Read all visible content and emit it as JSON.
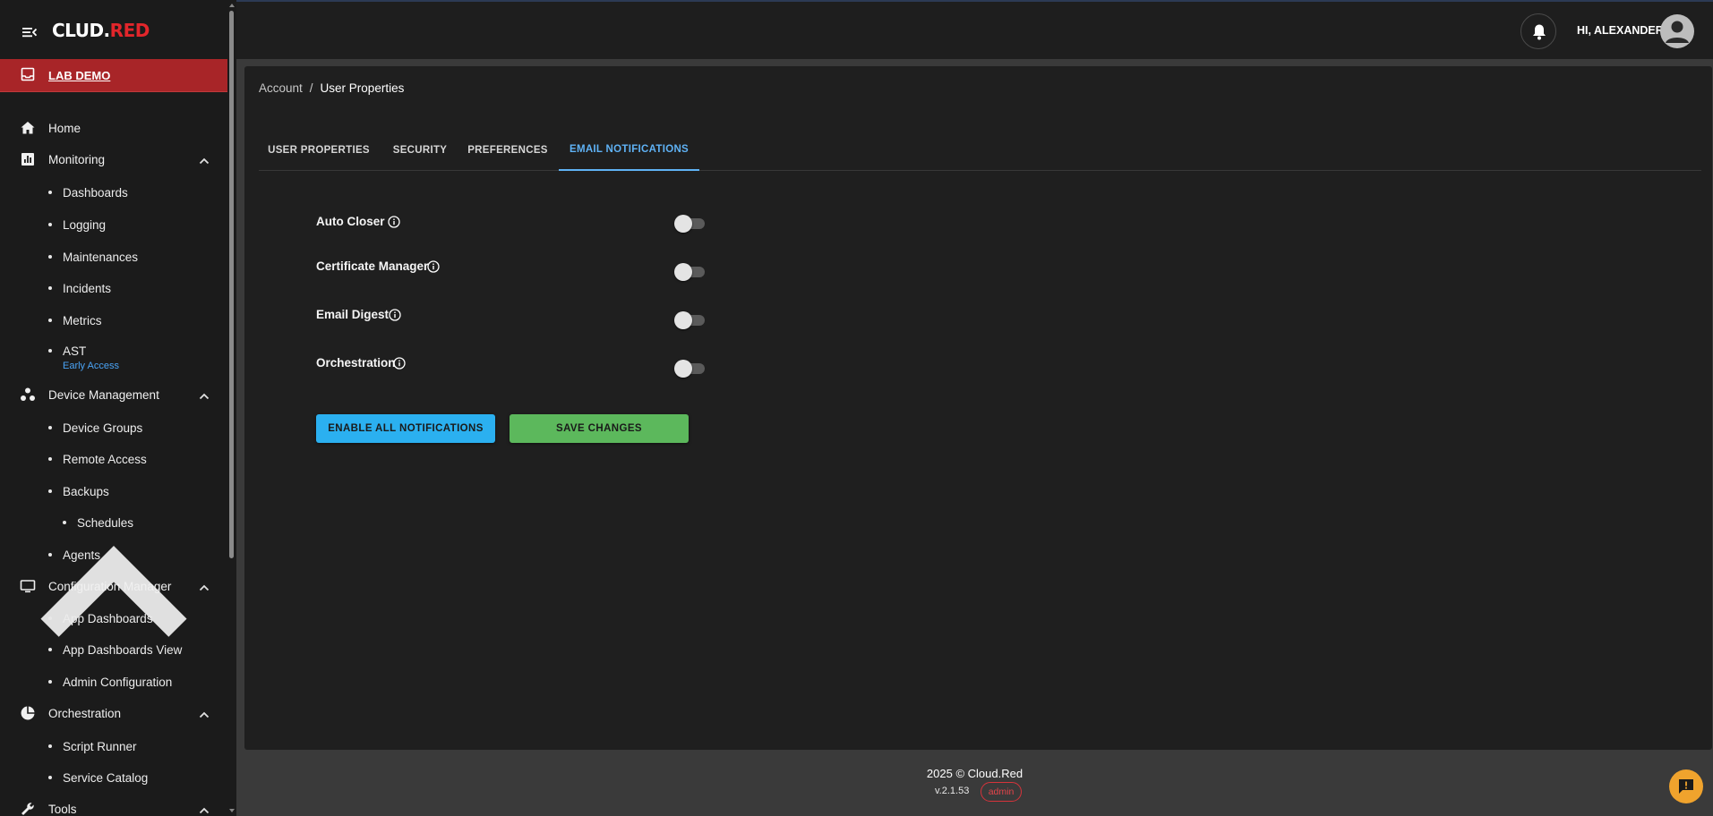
{
  "app": {
    "logo_part1": "CL",
    "logo_part2": "UD.",
    "logo_part3": "RED",
    "lab_label": "LAB DEMO"
  },
  "header": {
    "greeting": "HI, ALEXANDER"
  },
  "sidebar": {
    "home": "Home",
    "monitoring": {
      "label": "Monitoring",
      "items": [
        "Dashboards",
        "Logging",
        "Maintenances",
        "Incidents",
        "Metrics",
        "AST"
      ],
      "ast_badge": "Early Access"
    },
    "device_management": {
      "label": "Device Management",
      "items": [
        "Device Groups",
        "Remote Access",
        "Backups",
        "Agents"
      ],
      "backups_items": [
        "Schedules"
      ]
    },
    "configuration_manager": {
      "label": "Configuration Manager",
      "items": [
        "App Dashboards",
        "App Dashboards View",
        "Admin Configuration"
      ]
    },
    "orchestration": {
      "label": "Orchestration",
      "items": [
        "Script Runner",
        "Service Catalog"
      ]
    },
    "tools": {
      "label": "Tools"
    }
  },
  "breadcrumb": {
    "parent": "Account",
    "separator": "/",
    "current": "User Properties"
  },
  "tabs": [
    "USER PROPERTIES",
    "SECURITY",
    "PREFERENCES",
    "EMAIL NOTIFICATIONS"
  ],
  "active_tab": "EMAIL NOTIFICATIONS",
  "notifications": [
    {
      "label": "Auto Closer",
      "enabled": false
    },
    {
      "label": "Certificate Manager",
      "enabled": false
    },
    {
      "label": "Email Digest",
      "enabled": false
    },
    {
      "label": "Orchestration",
      "enabled": false
    }
  ],
  "buttons": {
    "enable_all": "ENABLE ALL NOTIFICATIONS",
    "save": "SAVE CHANGES"
  },
  "footer": {
    "copyright": "2025  © Cloud.Red",
    "version": "v.2.1.53",
    "role_badge": "admin"
  },
  "colors": {
    "accent_red": "#a82528",
    "tab_active": "#5fb2f5",
    "enable_button": "#2bb0f0",
    "save_button": "#5cb85c",
    "chat_button": "#f0a32d"
  }
}
